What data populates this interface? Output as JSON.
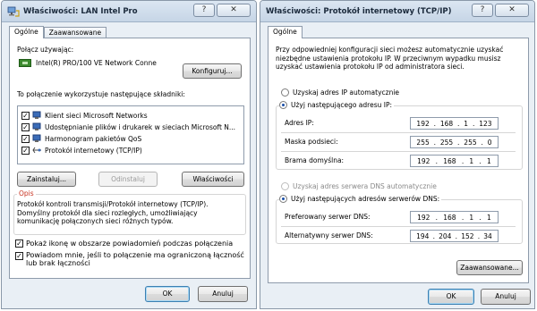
{
  "win1": {
    "title": "Właściwości: LAN Intel Pro",
    "tabs": [
      "Ogólne",
      "Zaawansowane"
    ],
    "connect_using_label": "Połącz używając:",
    "adapter_name": "Intel(R) PRO/100 VE Network Conne",
    "configure_label": "Konfiguruj...",
    "components_label": "To połączenie wykorzystuje następujące składniki:",
    "components": [
      {
        "label": "Klient sieci Microsoft Networks",
        "checked": true
      },
      {
        "label": "Udostępnianie plików i drukarek w sieciach Microsoft N...",
        "checked": true
      },
      {
        "label": "Harmonogram pakietów QoS",
        "checked": true
      },
      {
        "label": "Protokół internetowy (TCP/IP)",
        "checked": true
      }
    ],
    "install_label": "Zainstaluj...",
    "uninstall_label": "Odinstaluj",
    "properties_label": "Właściwości",
    "desc_title": "Opis",
    "desc_text_1": "Protokół kontroli transmisji/Protokół internetowy (TCP/IP).",
    "desc_text_2": "Domyślny protokół dla sieci rozległych, umożliwiający",
    "desc_text_3": "komunikację połączonych sieci różnych typów.",
    "show_icon_label": "Pokaż ikonę w obszarze powiadomień podczas połączenia",
    "notify_label_1": "Powiadom mnie, jeśli to połączenie ma ograniczoną łączność",
    "notify_label_2": "lub brak łączności",
    "ok_label": "OK",
    "cancel_label": "Anuluj"
  },
  "win2": {
    "title": "Właściwości: Protokół internetowy (TCP/IP)",
    "tabs": [
      "Ogólne"
    ],
    "intro_1": "Przy odpowiedniej konfiguracji sieci możesz automatycznie uzyskać",
    "intro_2": "niezbędne ustawienia protokołu IP. W przeciwnym wypadku musisz",
    "intro_3": "uzyskać ustawienia protokołu IP od administratora sieci.",
    "auto_ip_label": "Uzyskaj adres IP automatycznie",
    "manual_ip_label": "Użyj następującego adresu IP:",
    "ip_label": "Adres IP:",
    "ip": [
      "192",
      "168",
      "1",
      "123"
    ],
    "mask_label": "Maska podsieci:",
    "mask": [
      "255",
      "255",
      "255",
      "0"
    ],
    "gw_label": "Brama domyślna:",
    "gw": [
      "192",
      "168",
      "1",
      "1"
    ],
    "auto_dns_label": "Uzyskaj adres serwera DNS automatycznie",
    "manual_dns_label": "Użyj następujących adresów serwerów DNS:",
    "dns1_label": "Preferowany serwer DNS:",
    "dns1": [
      "192",
      "168",
      "1",
      "1"
    ],
    "dns2_label": "Alternatywny serwer DNS:",
    "dns2": [
      "194",
      "204",
      "152",
      "34"
    ],
    "advanced_label": "Zaawansowane...",
    "ok_label": "OK",
    "cancel_label": "Anuluj"
  },
  "titlebar_buttons": {
    "help": "?",
    "close": "✕"
  },
  "colors": {
    "accent": "#3c7fb1",
    "desc_title": "#c8311f",
    "window_bg": "#e9eff5"
  }
}
